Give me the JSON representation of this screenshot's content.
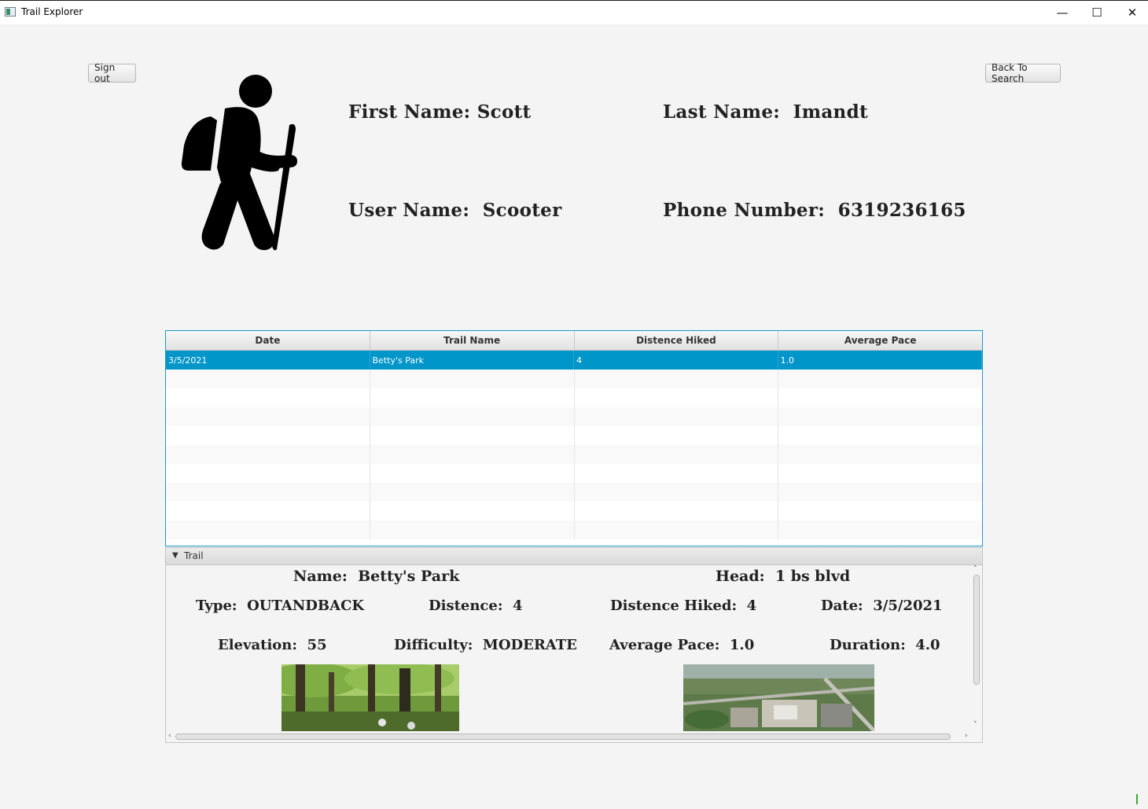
{
  "window": {
    "title": "Trail Explorer",
    "minimize_glyph": "—",
    "maximize_glyph": "☐",
    "close_glyph": "✕"
  },
  "buttons": {
    "sign_out": "Sign out",
    "back_to_search": "Back To Search"
  },
  "profile": {
    "first_name": "First Name: Scott",
    "last_name": "Last Name:  Imandt",
    "user_name": "User Name:  Scooter",
    "phone": "Phone Number:  6319236165",
    "avatar_icon": "hiker-icon"
  },
  "table": {
    "columns": [
      "Date",
      "Trail Name",
      "Distence Hiked",
      "Average Pace"
    ],
    "rows": [
      [
        "3/5/2021",
        "Betty's Park",
        "4",
        "1.0"
      ]
    ],
    "selection_color": "#0096c9",
    "border_color": "#1b9ad3"
  },
  "trail_pane": {
    "header": "Trail",
    "name": "Name:  Betty's Park",
    "head": "Head:  1 bs blvd",
    "type": "Type:  OUTANDBACK",
    "distence": "Distence:  4",
    "distence_hiked": "Distence Hiked:  4",
    "date": "Date:  3/5/2021",
    "elevation": "Elevation:  55",
    "difficulty": "Difficulty:  MODERATE",
    "average_pace": "Average Pace:  1.0",
    "duration": "Duration:  4.0"
  }
}
